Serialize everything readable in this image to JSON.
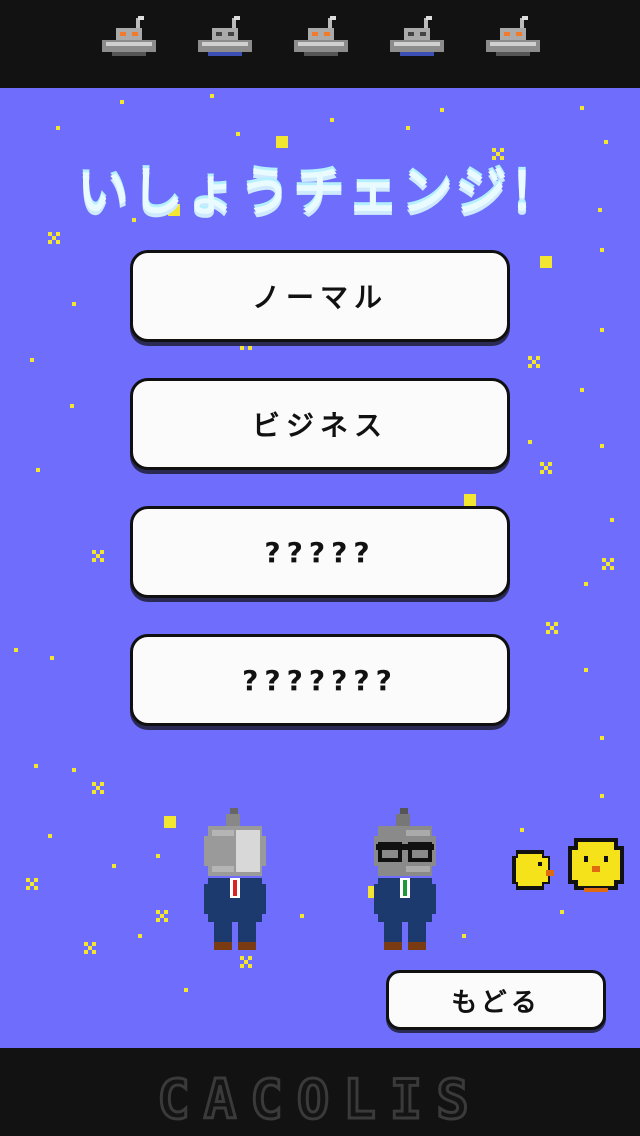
{
  "header": {
    "ufo_icons": [
      "ufo-icon",
      "ufo-icon",
      "ufo-icon",
      "ufo-icon",
      "ufo-icon"
    ]
  },
  "title": "いしょうチェンジ！",
  "menu": {
    "normal_label": "ノーマル",
    "business_label": "ビジネス",
    "locked1_label": "?????",
    "locked2_label": "???????"
  },
  "back_label": "もどる",
  "footer": {
    "brand": "CACOLIS"
  },
  "colors": {
    "sky": "#6f6dfb",
    "star": "#f2e633",
    "bar": "#121212",
    "button": "#fbfbfb"
  }
}
